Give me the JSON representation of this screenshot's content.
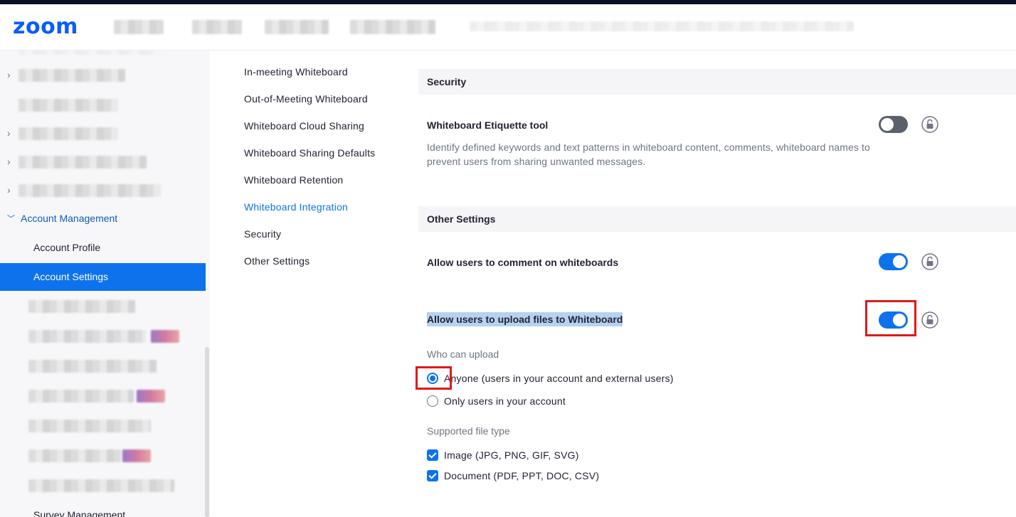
{
  "header": {
    "logo": "zoom"
  },
  "sidebar": {
    "account_management": "Account Management",
    "account_profile": "Account Profile",
    "account_settings": "Account Settings",
    "survey_management": "Survey Management"
  },
  "subnav": {
    "items": [
      "In-meeting Whiteboard",
      "Out-of-Meeting Whiteboard",
      "Whiteboard Cloud Sharing",
      "Whiteboard Sharing Defaults",
      "Whiteboard Retention",
      "Whiteboard Integration",
      "Security",
      "Other Settings"
    ],
    "active_index": 5
  },
  "security": {
    "heading": "Security",
    "etiquette": {
      "title": "Whiteboard Etiquette tool",
      "description": "Identify defined keywords and text patterns in whiteboard content, comments, whiteboard names to prevent users from sharing unwanted messages.",
      "enabled": false
    }
  },
  "other_settings": {
    "heading": "Other Settings",
    "comment": {
      "title": "Allow users to comment on whiteboards",
      "enabled": true
    },
    "upload": {
      "title": "Allow users to upload files to Whiteboard",
      "enabled": true,
      "who_label": "Who can upload",
      "options": [
        "Anyone (users in your account and external users)",
        "Only users in your account"
      ],
      "selected_index": 0,
      "file_type_label": "Supported file type",
      "file_types": [
        {
          "label": "Image (JPG, PNG, GIF, SVG)",
          "checked": true
        },
        {
          "label": "Document (PDF, PPT, DOC, CSV)",
          "checked": true
        }
      ]
    }
  },
  "colors": {
    "accent": "#0e72ed",
    "brand": "#0b5cff",
    "highlight": "#e01919"
  },
  "icons": {
    "lock": "lock-icon",
    "chevron": "chevron-right-icon"
  }
}
